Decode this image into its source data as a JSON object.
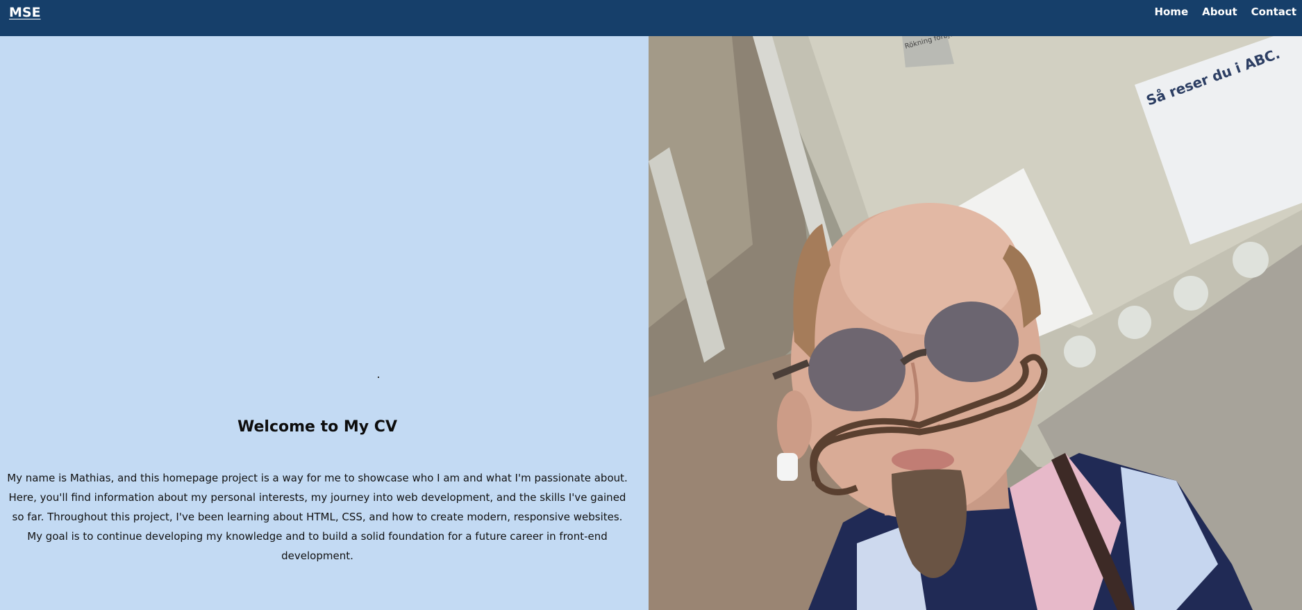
{
  "header": {
    "logo": "MSE",
    "nav": [
      {
        "label": "Home"
      },
      {
        "label": "About"
      },
      {
        "label": "Contact"
      }
    ]
  },
  "main": {
    "title": "Welcome to My CV",
    "intro": "My name is Mathias, and this homepage project is a way for me to showcase who I am and what I'm passionate about. Here, you'll find information about my personal interests, my journey into web development, and the skills I've gained so far. Throughout this project, I've been learning about HTML, CSS, and how to create modern, responsive websites. My goal is to continue developing my knowledge and to build a solid foundation for a future career in front-end development."
  },
  "photo": {
    "sign_text": "Så reser du i ABC.",
    "small_sign_text": "Rökning förbjuden"
  },
  "colors": {
    "nav_bg": "#163f6a",
    "left_bg": "#c3daf3"
  }
}
